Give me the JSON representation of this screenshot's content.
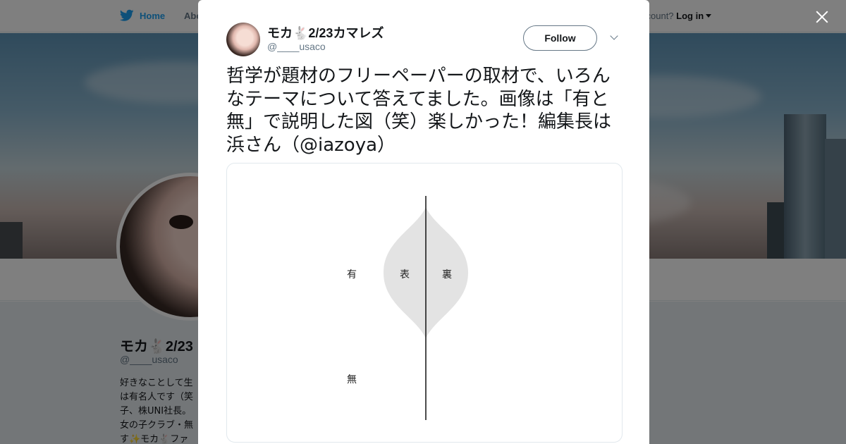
{
  "nav": {
    "home_label": "Home",
    "about_label": "Abo",
    "login_prefix": "ccount?",
    "login_label": "Log in"
  },
  "profile": {
    "name": "モカ🐇2/23",
    "handle": "@____usaco",
    "bio_lines": [
      "好きなことして生",
      "は有名人です（笑",
      "子、株UNI社長。",
      "女の子クラブ・無",
      "す✨モカ🐇ファ"
    ]
  },
  "tweet": {
    "author_name": "モカ🐇2/23カマレズ",
    "author_handle": "@____usaco",
    "follow_label": "Follow",
    "text": "哲学が題材のフリーペーパーの取材で、いろんなテーマについて答えてました。画像は「有と無」で説明した図（笑）楽しかった！編集長は浜さん（@iazoya）",
    "image": {
      "label_existence": "有",
      "label_nothingness": "無",
      "label_front": "表",
      "label_back": "裏"
    }
  },
  "colors": {
    "link": "#1da1f2",
    "overlay": "rgba(0,0,0,0.5)",
    "text": "#14171a",
    "secondary": "#657786",
    "shape_fill": "#e3e3e3"
  },
  "icons": [
    "twitter-bird-icon",
    "close-icon",
    "chevron-down-icon",
    "caret-down-icon"
  ]
}
